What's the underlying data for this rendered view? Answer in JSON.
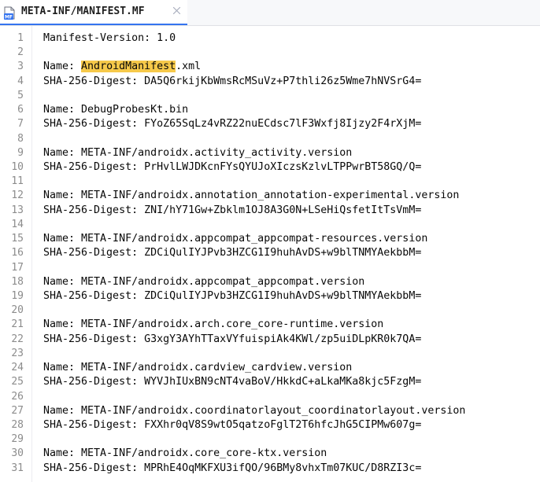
{
  "tab": {
    "title": "META-INF/MANIFEST.MF",
    "icon": "manifest-file-icon",
    "close_icon": "close-icon"
  },
  "editor": {
    "highlight_color": "#f6c94a",
    "lines": [
      {
        "no": "1",
        "text": "Manifest-Version: 1.0"
      },
      {
        "no": "2",
        "text": ""
      },
      {
        "no": "3",
        "text": "Name: AndroidManifest.xml",
        "pre": "Name: ",
        "match": "AndroidManifest",
        "post": ".xml"
      },
      {
        "no": "4",
        "text": "SHA-256-Digest: DA5Q6rkijKbWmsRcMSuVz+P7thli26z5Wme7hNVSrG4="
      },
      {
        "no": "5",
        "text": ""
      },
      {
        "no": "6",
        "text": "Name: DebugProbesKt.bin"
      },
      {
        "no": "7",
        "text": "SHA-256-Digest: FYoZ65SqLz4vRZ22nuECdsc7lF3Wxfj8Ijzy2F4rXjM="
      },
      {
        "no": "8",
        "text": ""
      },
      {
        "no": "9",
        "text": "Name: META-INF/androidx.activity_activity.version"
      },
      {
        "no": "10",
        "text": "SHA-256-Digest: PrHvlLWJDKcnFYsQYUJoXIczsKzlvLTPPwrBT58GQ/Q="
      },
      {
        "no": "11",
        "text": ""
      },
      {
        "no": "12",
        "text": "Name: META-INF/androidx.annotation_annotation-experimental.version"
      },
      {
        "no": "13",
        "text": "SHA-256-Digest: ZNI/hY71Gw+Zbklm1OJ8A3G0N+LSeHiQsfetItTsVmM="
      },
      {
        "no": "14",
        "text": ""
      },
      {
        "no": "15",
        "text": "Name: META-INF/androidx.appcompat_appcompat-resources.version"
      },
      {
        "no": "16",
        "text": "SHA-256-Digest: ZDCiQulIYJPvb3HZCG1I9huhAvDS+w9blTNMYAekbbM="
      },
      {
        "no": "17",
        "text": ""
      },
      {
        "no": "18",
        "text": "Name: META-INF/androidx.appcompat_appcompat.version"
      },
      {
        "no": "19",
        "text": "SHA-256-Digest: ZDCiQulIYJPvb3HZCG1I9huhAvDS+w9blTNMYAekbbM="
      },
      {
        "no": "20",
        "text": ""
      },
      {
        "no": "21",
        "text": "Name: META-INF/androidx.arch.core_core-runtime.version"
      },
      {
        "no": "22",
        "text": "SHA-256-Digest: G3xgY3AYhTTaxVYfuispiAk4KWl/zp5uiDLpKR0k7QA="
      },
      {
        "no": "23",
        "text": ""
      },
      {
        "no": "24",
        "text": "Name: META-INF/androidx.cardview_cardview.version"
      },
      {
        "no": "25",
        "text": "SHA-256-Digest: WYVJhIUxBN9cNT4vaBoV/HkkdC+aLkaMKa8kjc5FzgM="
      },
      {
        "no": "26",
        "text": ""
      },
      {
        "no": "27",
        "text": "Name: META-INF/androidx.coordinatorlayout_coordinatorlayout.version"
      },
      {
        "no": "28",
        "text": "SHA-256-Digest: FXXhr0qV8S9wtO5qatzoFglT2T6hfcJhG5CIPMw607g="
      },
      {
        "no": "29",
        "text": ""
      },
      {
        "no": "30",
        "text": "Name: META-INF/androidx.core_core-ktx.version"
      },
      {
        "no": "31",
        "text": "SHA-256-Digest: MPRhE4OqMKFXU3ifQO/96BMy8vhxTm07KUC/D8RZI3c="
      }
    ]
  }
}
